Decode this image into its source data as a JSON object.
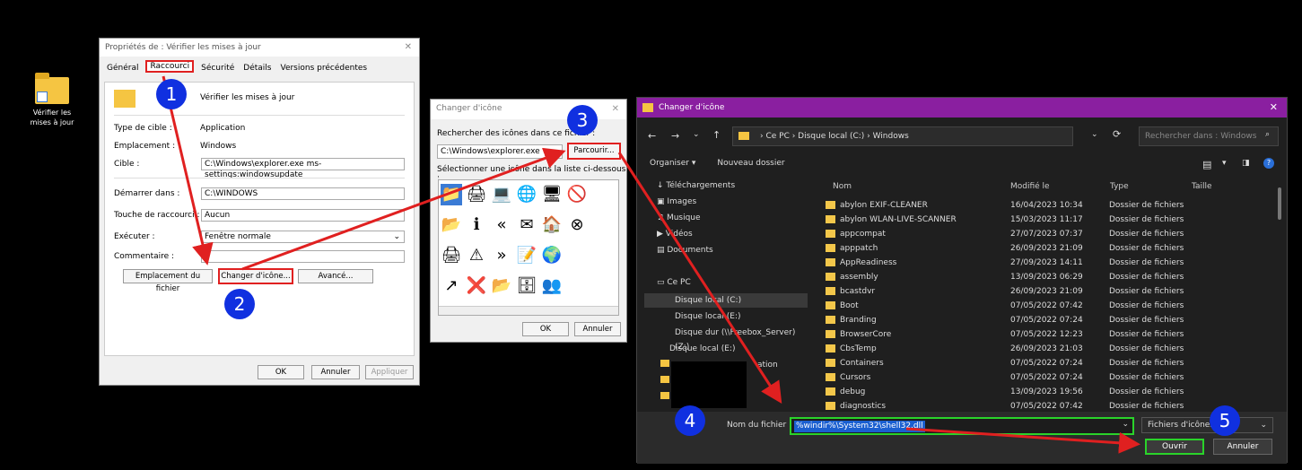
{
  "desktop": {
    "icon_label": "Vérifier les mises à jour"
  },
  "props": {
    "title": "Propriétés de : Vérifier les mises à jour",
    "tabs": [
      "Général",
      "Raccourci",
      "Sécurité",
      "Détails",
      "Versions précédentes"
    ],
    "name": "Vérifier les mises à jour",
    "type_label": "Type de cible :",
    "type_value": "Application",
    "loc_label": "Emplacement :",
    "loc_value": "Windows",
    "target_label": "Cible :",
    "target_value": "C:\\Windows\\explorer.exe ms-settings:windowsupdate",
    "start_label": "Démarrer dans :",
    "start_value": "C:\\WINDOWS",
    "key_label": "Touche de raccourci :",
    "key_value": "Aucun",
    "run_label": "Exécuter :",
    "run_value": "Fenêtre normale",
    "comment_label": "Commentaire :",
    "btn_location": "Emplacement du fichier",
    "btn_change": "Changer d'icône...",
    "btn_advanced": "Avancé...",
    "ok": "OK",
    "cancel": "Annuler",
    "apply": "Appliquer"
  },
  "chg": {
    "title": "Changer d'icône",
    "search_label": "Rechercher des icônes dans ce fichier :",
    "path": "C:\\Windows\\explorer.exe",
    "browse": "Parcourir...",
    "select_label": "Sélectionner une icône dans la liste ci-dessous :",
    "ok": "OK",
    "cancel": "Annuler"
  },
  "fd": {
    "title": "Changer d'icône",
    "breadcrumb": "›  Ce PC  ›  Disque local (C:)  ›  Windows",
    "search_placeholder": "Rechercher dans : Windows",
    "organize": "Organiser ▾",
    "new_folder": "Nouveau dossier",
    "side": [
      "Téléchargements",
      "Images",
      "Musique",
      "Vidéos",
      "Documents",
      "Ce PC",
      "Disque local (C:)",
      "Disque local (E:)",
      "Disque dur (\\\\Freebox_Server) (Z:)",
      "Disque local (E:)",
      "ation"
    ],
    "columns": [
      "Nom",
      "Modifié le",
      "Type",
      "Taille"
    ],
    "rows": [
      [
        "abylon EXIF-CLEANER",
        "16/04/2023 10:34",
        "Dossier de fichiers"
      ],
      [
        "abylon WLAN-LIVE-SCANNER",
        "15/03/2023 11:17",
        "Dossier de fichiers"
      ],
      [
        "appcompat",
        "27/07/2023 07:37",
        "Dossier de fichiers"
      ],
      [
        "apppatch",
        "26/09/2023 21:09",
        "Dossier de fichiers"
      ],
      [
        "AppReadiness",
        "27/09/2023 14:11",
        "Dossier de fichiers"
      ],
      [
        "assembly",
        "13/09/2023 06:29",
        "Dossier de fichiers"
      ],
      [
        "bcastdvr",
        "26/09/2023 21:09",
        "Dossier de fichiers"
      ],
      [
        "Boot",
        "07/05/2022 07:42",
        "Dossier de fichiers"
      ],
      [
        "Branding",
        "07/05/2022 07:24",
        "Dossier de fichiers"
      ],
      [
        "BrowserCore",
        "07/05/2022 12:23",
        "Dossier de fichiers"
      ],
      [
        "CbsTemp",
        "26/09/2023 21:03",
        "Dossier de fichiers"
      ],
      [
        "Containers",
        "07/05/2022 07:24",
        "Dossier de fichiers"
      ],
      [
        "Cursors",
        "07/05/2022 07:24",
        "Dossier de fichiers"
      ],
      [
        "debug",
        "13/09/2023 19:56",
        "Dossier de fichiers"
      ],
      [
        "diagnostics",
        "07/05/2022 07:42",
        "Dossier de fichiers"
      ]
    ],
    "fname_label": "Nom du fichier :",
    "fname_value": "%windir%\\System32\\shell32.dll",
    "ftype": "Fichiers d'icônes",
    "open": "Ouvrir",
    "cancel": "Annuler"
  },
  "steps": [
    "1",
    "2",
    "3",
    "4",
    "5"
  ],
  "colors": {
    "highlight_red": "#e02020",
    "highlight_green": "#2ad32a",
    "step_blue": "#1030e0",
    "titlebar_purple": "#8a1fa0"
  }
}
